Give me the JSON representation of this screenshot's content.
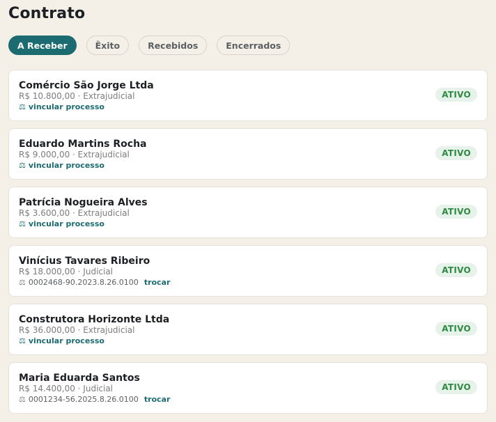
{
  "page": {
    "title": "Contrato"
  },
  "tabs": [
    {
      "label": "A Receber",
      "active": true
    },
    {
      "label": "Êxito",
      "active": false
    },
    {
      "label": "Recebidos",
      "active": false
    },
    {
      "label": "Encerrados",
      "active": false
    }
  ],
  "colors": {
    "accent": "#1b6b70",
    "badge_bg": "#e7f2ea",
    "badge_text": "#2f8a43",
    "background": "#f4efe7"
  },
  "icons": {
    "process": "scale-icon"
  },
  "contracts": [
    {
      "name": "Comércio São Jorge Ltda",
      "meta": "R$ 10.800,00 · Extrajudicial",
      "process_type": "link",
      "process_icon": "⚖",
      "process_text": "vincular processo",
      "status": "ATIVO"
    },
    {
      "name": "Eduardo Martins Rocha",
      "meta": "R$ 9.000,00 · Extrajudicial",
      "process_type": "link",
      "process_icon": "⚖",
      "process_text": "vincular processo",
      "status": "ATIVO"
    },
    {
      "name": "Patrícia Nogueira Alves",
      "meta": "R$ 3.600,00 · Extrajudicial",
      "process_type": "link",
      "process_icon": "⚖",
      "process_text": "vincular processo",
      "status": "ATIVO"
    },
    {
      "name": "Vinícius Tavares Ribeiro",
      "meta": "R$ 18.000,00 · Judicial",
      "process_type": "number",
      "process_icon": "⚖",
      "process_text": "0002468-90.2023.8.26.0100",
      "process_action": "trocar",
      "status": "ATIVO"
    },
    {
      "name": "Construtora Horizonte Ltda",
      "meta": "R$ 36.000,00 · Extrajudicial",
      "process_type": "link",
      "process_icon": "⚖",
      "process_text": "vincular processo",
      "status": "ATIVO"
    },
    {
      "name": "Maria Eduarda Santos",
      "meta": "R$ 14.400,00 · Judicial",
      "process_type": "number",
      "process_icon": "⚖",
      "process_text": "0001234-56.2025.8.26.0100",
      "process_action": "trocar",
      "status": "ATIVO"
    }
  ]
}
